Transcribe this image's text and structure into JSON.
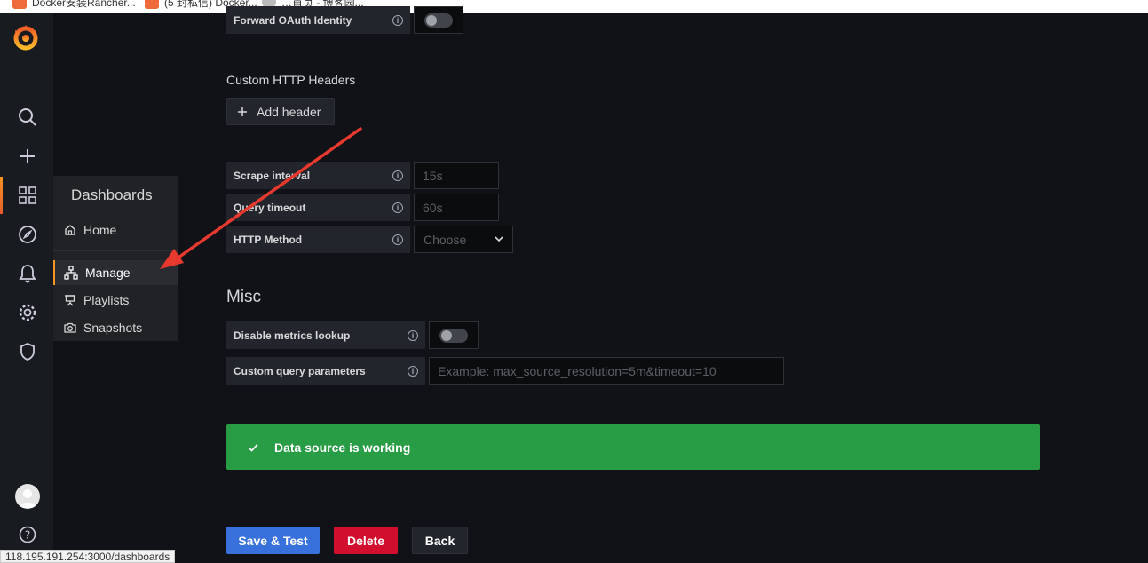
{
  "browser": {
    "bookmarks": [
      {
        "label": "Docker安装Rancher..."
      },
      {
        "label": "(5 封私信) Docker..."
      },
      {
        "label": "…首页 - 博客园..."
      }
    ],
    "status_url": "118.195.191.254:3000/dashboards"
  },
  "sidenav": {
    "items": [
      "search-icon",
      "plus-icon",
      "dashboards-icon",
      "explore-icon",
      "alerting-icon",
      "configuration-icon",
      "shield-icon",
      "help-icon"
    ]
  },
  "dashboards_menu": {
    "title": "Dashboards",
    "items": [
      {
        "label": "Home",
        "icon": "home-icon"
      },
      {
        "label": "Manage",
        "icon": "sitemap-icon"
      },
      {
        "label": "Playlists",
        "icon": "presentation-icon"
      },
      {
        "label": "Snapshots",
        "icon": "camera-icon"
      }
    ]
  },
  "auth": {
    "forward_oauth_label": "Forward OAuth Identity",
    "forward_oauth_enabled": false
  },
  "custom_headers": {
    "title": "Custom HTTP Headers",
    "add_button": "Add header"
  },
  "prometheus": {
    "scrape_interval_label": "Scrape interval",
    "scrape_interval_placeholder": "15s",
    "query_timeout_label": "Query timeout",
    "query_timeout_placeholder": "60s",
    "http_method_label": "HTTP Method",
    "http_method_placeholder": "Choose"
  },
  "misc": {
    "title": "Misc",
    "disable_metrics_label": "Disable metrics lookup",
    "disable_metrics_enabled": false,
    "custom_query_label": "Custom query parameters",
    "custom_query_placeholder": "Example: max_source_resolution=5m&timeout=10"
  },
  "alert": {
    "message": "Data source is working"
  },
  "actions": {
    "save_test": "Save & Test",
    "delete": "Delete",
    "back": "Back"
  },
  "colors": {
    "accent": "#f79520",
    "success": "#299c46",
    "primary": "#3871dc",
    "danger": "#d10e2e",
    "annotation_arrow": "#e8392f"
  }
}
